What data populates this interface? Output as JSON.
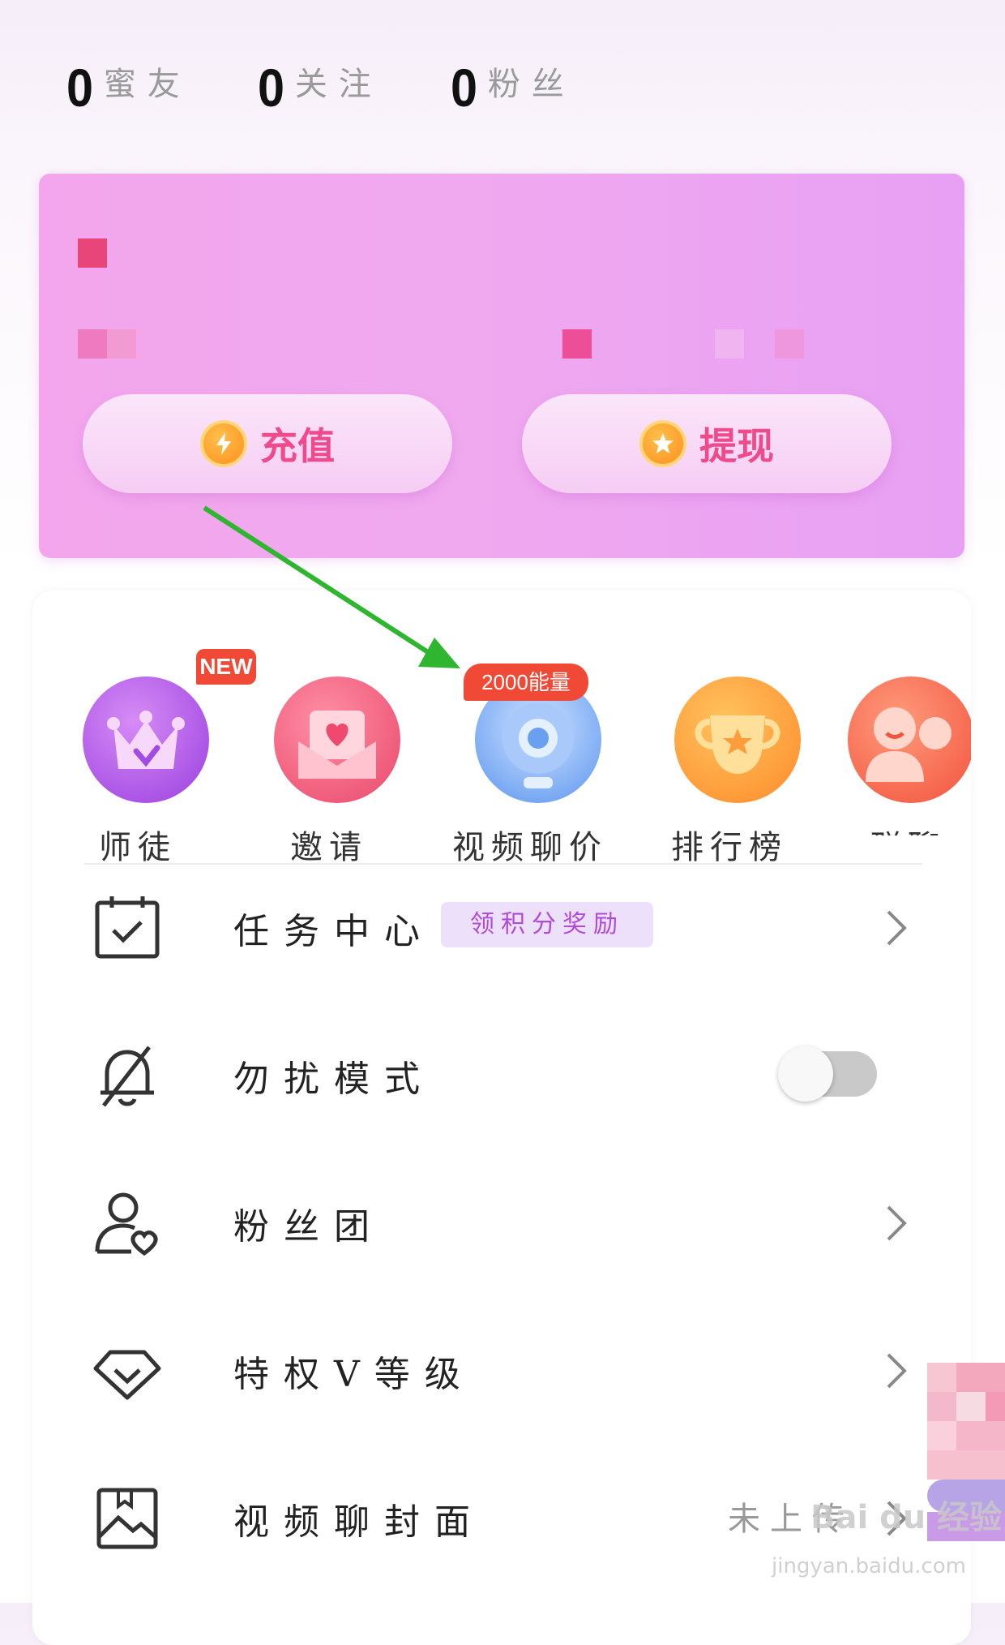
{
  "stats": [
    {
      "count": "0",
      "label": "蜜友"
    },
    {
      "count": "0",
      "label": "关注"
    },
    {
      "count": "0",
      "label": "粉丝"
    }
  ],
  "wallet": {
    "recharge_label": "充值",
    "withdraw_label": "提现"
  },
  "quick_actions": [
    {
      "label": "师徒",
      "badge": "NEW",
      "icon": "crown-icon"
    },
    {
      "label": "邀请",
      "badge": "",
      "icon": "envelope-heart-icon"
    },
    {
      "label": "视频聊价",
      "badge": "2000能量",
      "icon": "camera-icon"
    },
    {
      "label": "排行榜",
      "badge": "",
      "icon": "trophy-icon"
    },
    {
      "label": "群聊",
      "badge": "",
      "icon": "group-chat-icon"
    }
  ],
  "menu": {
    "task_center": {
      "label": "任务中心",
      "tag": "领积分奖励",
      "icon": "calendar-check-icon"
    },
    "do_not_disturb": {
      "label": "勿扰模式",
      "icon": "bell-off-icon",
      "enabled": false
    },
    "fan_club": {
      "label": "粉丝团",
      "icon": "user-heart-icon"
    },
    "vip_level": {
      "label": "特权V等级",
      "icon": "diamond-icon"
    },
    "video_cover": {
      "label": "视频聊封面",
      "value": "未上传",
      "icon": "image-icon"
    }
  },
  "watermark": {
    "main": "Bai du 经验",
    "sub": "jingyan.baidu.com"
  },
  "colors": {
    "wallet_card": "#f0a9ef",
    "button_text": "#ee4a8c",
    "tag_bg": "#ece0fb",
    "tag_text": "#b04ad8",
    "badge": "#f04a37",
    "annotation_arrow": "#2fb52f"
  }
}
